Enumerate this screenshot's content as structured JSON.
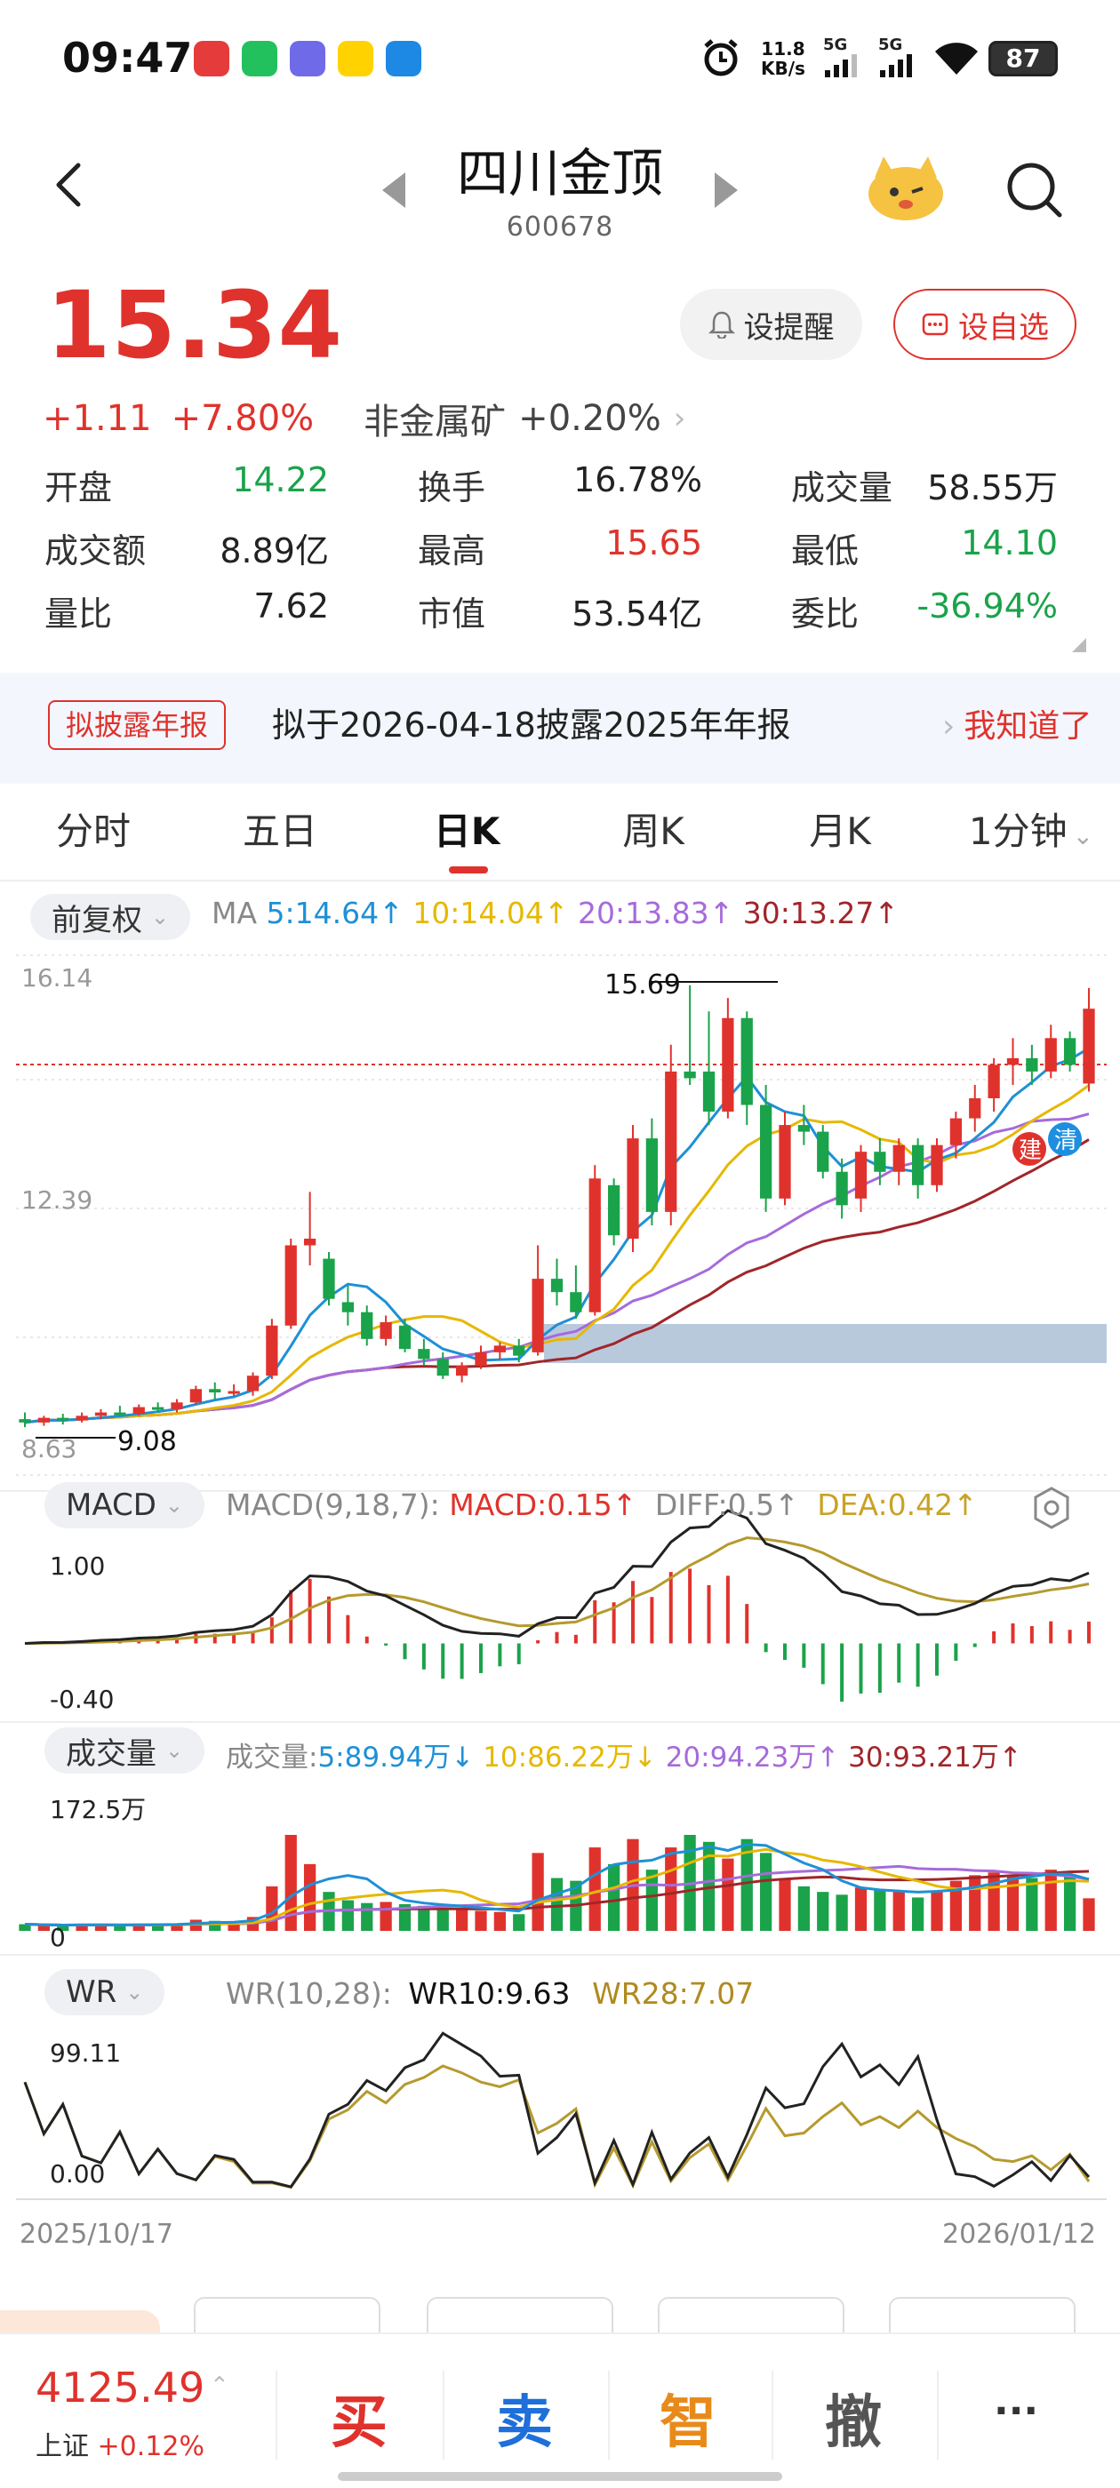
{
  "status": {
    "time": "09:47",
    "net_speed_value": "11.8",
    "net_speed_unit": "KB/s",
    "signal1": "5G",
    "signal2": "5G",
    "battery": "87"
  },
  "header": {
    "title": "四川金顶",
    "code": "600678"
  },
  "quote": {
    "price": "15.34",
    "change": "+1.11",
    "change_pct": "+7.80%",
    "sector_name": "非金属矿",
    "sector_pct": "+0.20%",
    "remind_label": "设提醒",
    "fav_label": "设自选"
  },
  "stats": [
    [
      {
        "label": "开盘",
        "value": "14.22",
        "color": "green"
      },
      {
        "label": "换手",
        "value": "16.78%",
        "color": "black"
      },
      {
        "label": "成交量",
        "value": "58.55万",
        "color": "black"
      }
    ],
    [
      {
        "label": "成交额",
        "value": "8.89亿",
        "color": "black"
      },
      {
        "label": "最高",
        "value": "15.65",
        "color": "red"
      },
      {
        "label": "最低",
        "value": "14.10",
        "color": "green"
      }
    ],
    [
      {
        "label": "量比",
        "value": "7.62",
        "color": "black"
      },
      {
        "label": "市值",
        "value": "53.54亿",
        "color": "black"
      },
      {
        "label": "委比",
        "value": "-36.94%",
        "color": "green"
      }
    ]
  ],
  "banner": {
    "tag": "拟披露年报",
    "text": "拟于2026-04-18披露2025年年报",
    "action": "我知道了"
  },
  "tabs": [
    "分时",
    "五日",
    "日K",
    "周K",
    "月K",
    "1分钟"
  ],
  "active_tab": "日K",
  "kline": {
    "adjust_label": "前复权",
    "ma_label": "MA",
    "ma5": "5:14.64↑",
    "ma10": "10:14.04↑",
    "ma20": "20:13.83↑",
    "ma30": "30:13.27↑",
    "axis_top": "16.14",
    "axis_mid": "12.39",
    "axis_bottom": "8.63",
    "high_label": "15.69",
    "low_label": "9.08",
    "badge1": "建",
    "badge2": "清"
  },
  "macd": {
    "chip": "MACD",
    "params": "MACD(9,18,7):",
    "macd": "MACD:0.15↑",
    "diff": "DIFF:0.5↑",
    "dea": "DEA:0.42↑",
    "axis_top": "1.00",
    "axis_bottom": "-0.40"
  },
  "volume": {
    "chip": "成交量",
    "prefix": "成交量:",
    "ma5": "5:89.94万↓",
    "ma10": "10:86.22万↓",
    "ma20": "20:94.23万↑",
    "ma30": "30:93.21万↑",
    "axis_top": "172.5万",
    "axis_bottom": "0"
  },
  "wr": {
    "chip": "WR",
    "params": "WR(10,28):",
    "wr10": "WR10:9.63",
    "wr28": "WR28:7.07",
    "axis_top": "99.11",
    "axis_bottom": "0.00"
  },
  "dates": {
    "start": "2025/10/17",
    "end": "2026/01/12"
  },
  "bottom": {
    "index_value": "4125.49",
    "index_name": "上证",
    "index_pct": "+0.12%",
    "buy": "买",
    "sell": "卖",
    "smart": "智",
    "cancel": "撤",
    "more": "···"
  },
  "colors": {
    "up": "#e0322c",
    "down": "#1aa34a",
    "ma5": "#1e90d6",
    "ma10": "#e6b800",
    "ma20": "#a66bdb",
    "ma30": "#a0262a"
  },
  "chart_data": {
    "type": "candlestick",
    "ohlc": [
      [
        9.2,
        9.3,
        9.08,
        9.15
      ],
      [
        9.15,
        9.25,
        9.1,
        9.22
      ],
      [
        9.22,
        9.28,
        9.12,
        9.18
      ],
      [
        9.18,
        9.3,
        9.15,
        9.25
      ],
      [
        9.25,
        9.35,
        9.2,
        9.3
      ],
      [
        9.3,
        9.4,
        9.25,
        9.28
      ],
      [
        9.28,
        9.42,
        9.25,
        9.38
      ],
      [
        9.38,
        9.45,
        9.3,
        9.35
      ],
      [
        9.35,
        9.5,
        9.3,
        9.45
      ],
      [
        9.45,
        9.7,
        9.42,
        9.65
      ],
      [
        9.65,
        9.75,
        9.5,
        9.6
      ],
      [
        9.6,
        9.72,
        9.55,
        9.62
      ],
      [
        9.62,
        9.9,
        9.55,
        9.85
      ],
      [
        9.85,
        10.7,
        9.8,
        10.6
      ],
      [
        10.6,
        11.9,
        10.55,
        11.8
      ],
      [
        11.8,
        12.6,
        11.5,
        11.9
      ],
      [
        11.6,
        11.7,
        10.9,
        11.0
      ],
      [
        10.95,
        11.2,
        10.6,
        10.8
      ],
      [
        10.8,
        10.9,
        10.3,
        10.4
      ],
      [
        10.4,
        10.75,
        10.3,
        10.65
      ],
      [
        10.6,
        10.7,
        10.2,
        10.25
      ],
      [
        10.25,
        10.4,
        10.0,
        10.1
      ],
      [
        10.1,
        10.2,
        9.8,
        9.85
      ],
      [
        9.85,
        10.05,
        9.75,
        10.0
      ],
      [
        10.0,
        10.3,
        9.95,
        10.2
      ],
      [
        10.2,
        10.35,
        10.1,
        10.3
      ],
      [
        10.3,
        10.4,
        10.05,
        10.15
      ],
      [
        10.2,
        11.8,
        10.15,
        11.3
      ],
      [
        11.3,
        11.6,
        10.9,
        11.1
      ],
      [
        11.1,
        11.5,
        10.7,
        10.8
      ],
      [
        10.8,
        13.0,
        10.75,
        12.8
      ],
      [
        12.7,
        12.8,
        11.8,
        11.95
      ],
      [
        11.9,
        13.6,
        11.7,
        13.4
      ],
      [
        13.4,
        13.7,
        12.1,
        12.3
      ],
      [
        12.3,
        14.8,
        12.1,
        14.4
      ],
      [
        14.4,
        15.69,
        14.2,
        14.3
      ],
      [
        14.4,
        15.3,
        13.6,
        13.8
      ],
      [
        13.8,
        15.5,
        13.7,
        15.2
      ],
      [
        15.2,
        15.3,
        13.6,
        13.9
      ],
      [
        13.9,
        14.2,
        12.3,
        12.5
      ],
      [
        12.5,
        13.8,
        12.4,
        13.6
      ],
      [
        13.6,
        13.9,
        13.3,
        13.5
      ],
      [
        13.5,
        13.6,
        12.8,
        12.9
      ],
      [
        12.9,
        13.1,
        12.2,
        12.4
      ],
      [
        12.5,
        13.3,
        12.3,
        13.2
      ],
      [
        13.2,
        13.4,
        12.7,
        12.9
      ],
      [
        12.9,
        13.4,
        12.7,
        13.3
      ],
      [
        13.3,
        13.4,
        12.5,
        12.7
      ],
      [
        12.7,
        13.4,
        12.6,
        13.3
      ],
      [
        13.3,
        13.8,
        13.1,
        13.7
      ],
      [
        13.7,
        14.2,
        13.5,
        14.0
      ],
      [
        14.0,
        14.6,
        13.8,
        14.5
      ],
      [
        14.5,
        14.9,
        14.2,
        14.6
      ],
      [
        14.6,
        14.8,
        14.2,
        14.4
      ],
      [
        14.4,
        15.1,
        14.3,
        14.9
      ],
      [
        14.9,
        15.0,
        14.4,
        14.5
      ],
      [
        14.22,
        15.65,
        14.1,
        15.34
      ]
    ],
    "volume_wan": [
      12,
      10,
      9,
      11,
      12,
      10,
      12,
      11,
      13,
      20,
      18,
      16,
      25,
      80,
      172.5,
      120,
      70,
      55,
      50,
      52,
      48,
      45,
      40,
      38,
      36,
      34,
      30,
      140,
      95,
      90,
      150,
      120,
      165,
      110,
      150,
      172.5,
      160,
      130,
      165,
      140,
      95,
      80,
      70,
      65,
      78,
      75,
      70,
      60,
      72,
      90,
      100,
      105,
      100,
      95,
      110,
      100,
      58.55
    ],
    "ylim": [
      8.63,
      16.14
    ],
    "xlabel_start": "2025/10/17",
    "xlabel_end": "2026/01/12"
  }
}
